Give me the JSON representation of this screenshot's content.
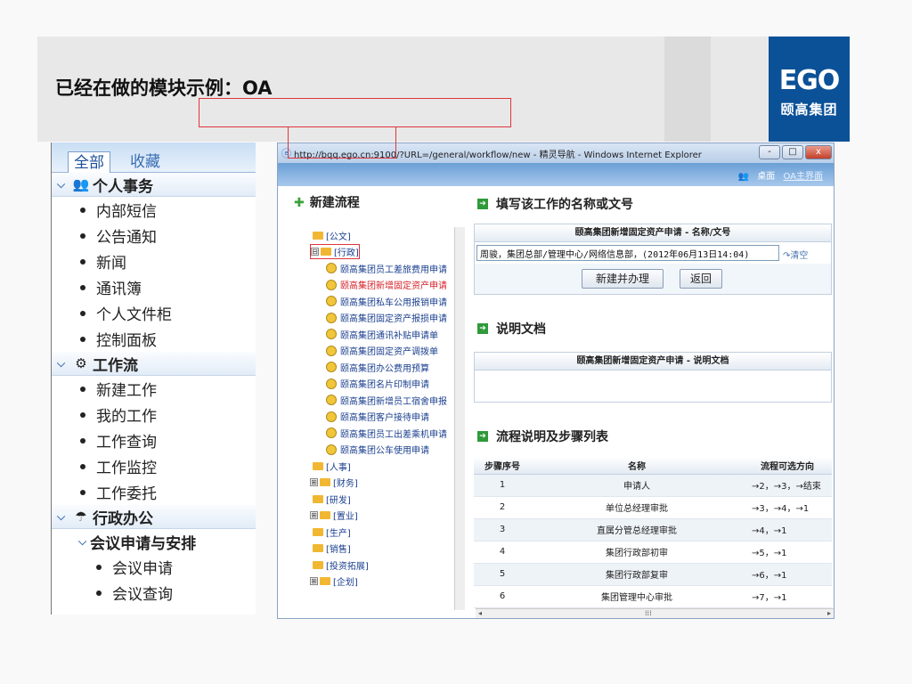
{
  "slide": {
    "title": "已经在做的模块示例：OA",
    "logo_mark": "EGO",
    "logo_text": "颐高集团",
    "brand_color": "#0b5198"
  },
  "nav": {
    "tab_all": "全部",
    "tab_fav": "收藏",
    "sections": [
      {
        "icon": "people-icon",
        "label": "个人事务",
        "items": [
          "内部短信",
          "公告通知",
          "新闻",
          "通讯簿",
          "个人文件柜",
          "控制面板"
        ]
      },
      {
        "icon": "workflow-icon",
        "label": "工作流",
        "items": [
          "新建工作",
          "我的工作",
          "工作查询",
          "工作监控",
          "工作委托"
        ]
      },
      {
        "icon": "office-icon",
        "label": "行政办公",
        "subsection": "会议申请与安排",
        "items": [
          "会议申请",
          "会议查询"
        ]
      }
    ]
  },
  "browser": {
    "title": "http://bqq.ego.cn:9100/?URL=/general/workflow/new - 精灵导航 - Windows Internet Explorer",
    "buttons": {
      "min": "-",
      "max": "□",
      "close": "x"
    },
    "link_desktop": "桌面",
    "link_oa_home": "OA主界面"
  },
  "tree": {
    "heading": "新建流程",
    "nodes": [
      {
        "level": 0,
        "label": "[公文]",
        "expander": ""
      },
      {
        "level": 0,
        "label": "[行政]",
        "expander": "⊟",
        "highlight": true
      },
      {
        "level": 1,
        "label": "颐高集团员工差旅费用申请"
      },
      {
        "level": 1,
        "label": "颐高集团新增固定资产申请",
        "selected": true
      },
      {
        "level": 1,
        "label": "颐高集团私车公用报销申请"
      },
      {
        "level": 1,
        "label": "颐高集团固定资产报损申请"
      },
      {
        "level": 1,
        "label": "颐高集团通讯补贴申请单"
      },
      {
        "level": 1,
        "label": "颐高集团固定资产调拨单"
      },
      {
        "level": 1,
        "label": "颐高集团办公费用预算"
      },
      {
        "level": 1,
        "label": "颐高集团名片印制申请"
      },
      {
        "level": 1,
        "label": "颐高集团新增员工宿舍申报"
      },
      {
        "level": 1,
        "label": "颐高集团客户接待申请"
      },
      {
        "level": 1,
        "label": "颐高集团员工出差乘机申请"
      },
      {
        "level": 1,
        "label": "颐高集团公车使用申请"
      },
      {
        "level": 0,
        "label": "[人事]",
        "expander": ""
      },
      {
        "level": 0,
        "label": "[财务]",
        "expander": "⊞"
      },
      {
        "level": 0,
        "label": "[研发]",
        "expander": ""
      },
      {
        "level": 0,
        "label": "[置业]",
        "expander": "⊞"
      },
      {
        "level": 0,
        "label": "[生产]",
        "expander": ""
      },
      {
        "level": 0,
        "label": "[销售]",
        "expander": ""
      },
      {
        "level": 0,
        "label": "[投资拓展]",
        "expander": ""
      },
      {
        "level": 0,
        "label": "[企划]",
        "expander": "⊞"
      }
    ]
  },
  "form": {
    "name_heading": "填写该工作的名称或文号",
    "name_panel_title": "颐高集团新增固定资产申请 - 名称/文号",
    "name_value": "周骏，集团总部/管理中心/网络信息部，(2012年06月13日14:04)",
    "clear_label": "清空",
    "create_button": "新建并办理",
    "back_button": "返回",
    "doc_heading": "说明文档",
    "doc_panel_title": "颐高集团新增固定资产申请 - 说明文档",
    "steps_heading": "流程说明及步骤列表",
    "steps_columns": [
      "步骤序号",
      "名称",
      "流程可选方向"
    ],
    "steps": [
      [
        "1",
        "申请人",
        "→2，→3，→结束"
      ],
      [
        "2",
        "单位总经理审批",
        "→3，→4，→1"
      ],
      [
        "3",
        "直属分管总经理审批",
        "→4，→1"
      ],
      [
        "4",
        "集团行政部初审",
        "→5，→1"
      ],
      [
        "5",
        "集团行政部复审",
        "→6，→1"
      ],
      [
        "6",
        "集团管理中心审批",
        "→7，→1"
      ]
    ]
  }
}
